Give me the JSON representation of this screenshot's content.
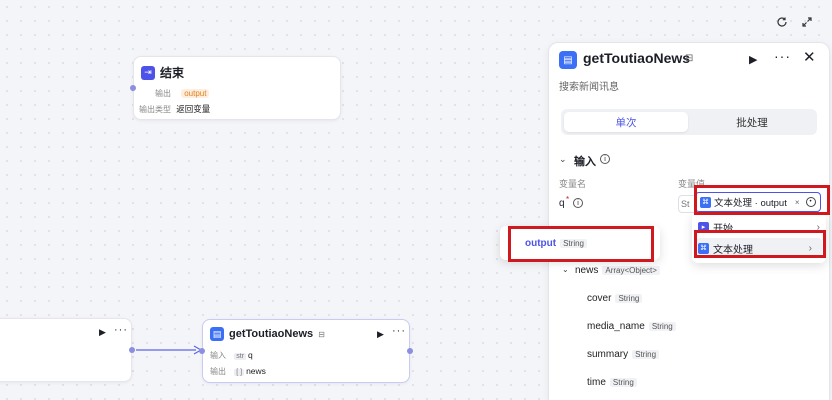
{
  "toolbar": {
    "refresh_icon": "refresh-icon",
    "expand_icon": "expand-icon"
  },
  "end_node": {
    "title": "结束",
    "output_label": "输出",
    "output_value": "output",
    "output_type_label": "输出类型",
    "output_type_value": "返回变量"
  },
  "tool_node": {
    "title": "getToutiaoNews",
    "input_label": "输入",
    "input_value": "q",
    "input_tag": "str",
    "output_label": "输出",
    "output_value": "news",
    "output_tag": "[ ]"
  },
  "panel": {
    "title": "getToutiaoNews",
    "description": "搜索新闻讯息",
    "tabs": [
      "单次",
      "批处理"
    ],
    "input_section": "输入",
    "col_var_name": "变量名",
    "col_var_value": "变量值",
    "param_name": "q",
    "param_required": "*",
    "param_type_stub": "St",
    "selected_ref": "文本处理 · output",
    "tree": [
      {
        "name": "news",
        "type": "Array<Object>"
      },
      {
        "name": "cover",
        "type": "String"
      },
      {
        "name": "media_name",
        "type": "String"
      },
      {
        "name": "summary",
        "type": "String"
      },
      {
        "name": "time",
        "type": "String"
      }
    ]
  },
  "dropdown_left": {
    "name": "output",
    "type": "String"
  },
  "dropdown_right": {
    "items": [
      "开始",
      "文本处理"
    ]
  },
  "colors": {
    "accent": "#4d53e8",
    "highlight": "#d0191f"
  }
}
